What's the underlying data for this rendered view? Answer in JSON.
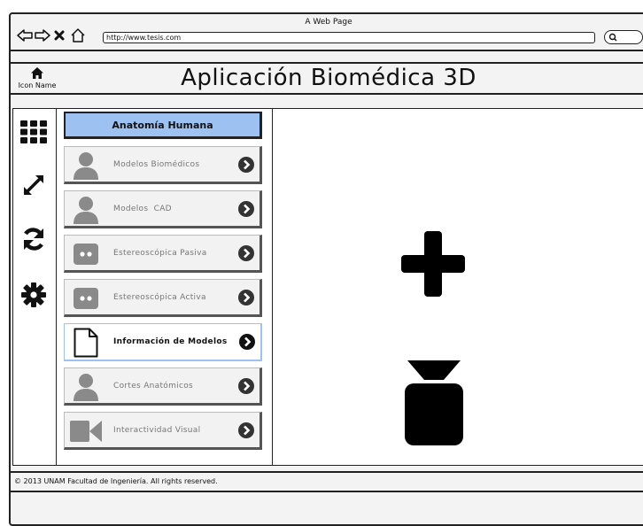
{
  "browser": {
    "window_title": "A Web Page",
    "url": "http://www.tesis.com"
  },
  "app": {
    "home_icon_label": "Icon Name",
    "title": "Aplicación Biomédica 3D"
  },
  "toolbar": {
    "tools": [
      {
        "icon": "grid-icon"
      },
      {
        "icon": "expand-arrows-icon"
      },
      {
        "icon": "refresh-icon"
      },
      {
        "icon": "gear-icon"
      }
    ]
  },
  "panel": {
    "header": "Anatomía Humana",
    "items": [
      {
        "label": "Modelos Biomédicos",
        "icon": "user-icon",
        "active": false
      },
      {
        "label": "Modelos  CAD",
        "icon": "user-icon",
        "active": false
      },
      {
        "label": "Estereoscópica Pasiva",
        "icon": "glasses-icon",
        "active": false
      },
      {
        "label": "Estereoscópica Activa",
        "icon": "glasses-icon",
        "active": false
      },
      {
        "label": "Información de Modelos",
        "icon": "document-icon",
        "active": true
      },
      {
        "label": "Cortes Anatómicos",
        "icon": "user-icon",
        "active": false
      },
      {
        "label": "Interactividad Visual",
        "icon": "video-camera-icon",
        "active": false
      }
    ]
  },
  "canvas": {
    "icons": [
      "plus-icon",
      "flask-icon"
    ]
  },
  "footer": {
    "text": "© 2013 UNAM Facultad de Ingeniería. All rights reserved."
  },
  "colors": {
    "header_blue": "#9dc1f0",
    "active_border": "#9dc1f0",
    "muted_icon": "#8a8a8a",
    "ink": "#111111"
  }
}
